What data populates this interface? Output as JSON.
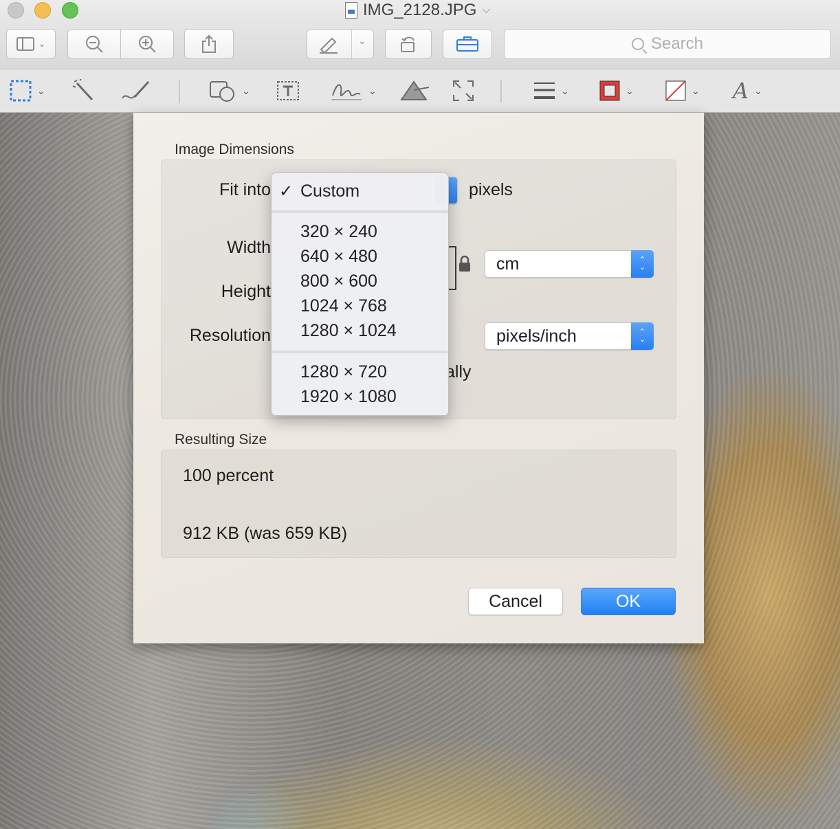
{
  "window": {
    "title": "IMG_2128.JPG"
  },
  "toolbar": {
    "search_placeholder": "Search"
  },
  "dialog": {
    "image_dimensions_label": "Image Dimensions",
    "fit_into_label": "Fit into",
    "fit_into_unit": "pixels",
    "width_label": "Width",
    "height_label": "Height",
    "resolution_label": "Resolution",
    "dimension_unit": "cm",
    "resolution_unit": "pixels/inch",
    "resample_partial": "ally",
    "resulting_size_label": "Resulting Size",
    "result_percent": "100 percent",
    "result_filesize": "912 KB (was 659 KB)",
    "cancel_label": "Cancel",
    "ok_label": "OK"
  },
  "fit_menu": {
    "checkmark": "✓",
    "selected": "Custom",
    "group1": [
      "320 × 240",
      "640 × 480",
      "800 × 600",
      "1024 × 768",
      "1280 × 1024"
    ],
    "group2": [
      "1280 × 720",
      "1920 × 1080"
    ]
  },
  "colors": {
    "accent": "#2a7ef0",
    "border_color_swatch": "#e03a3a"
  }
}
